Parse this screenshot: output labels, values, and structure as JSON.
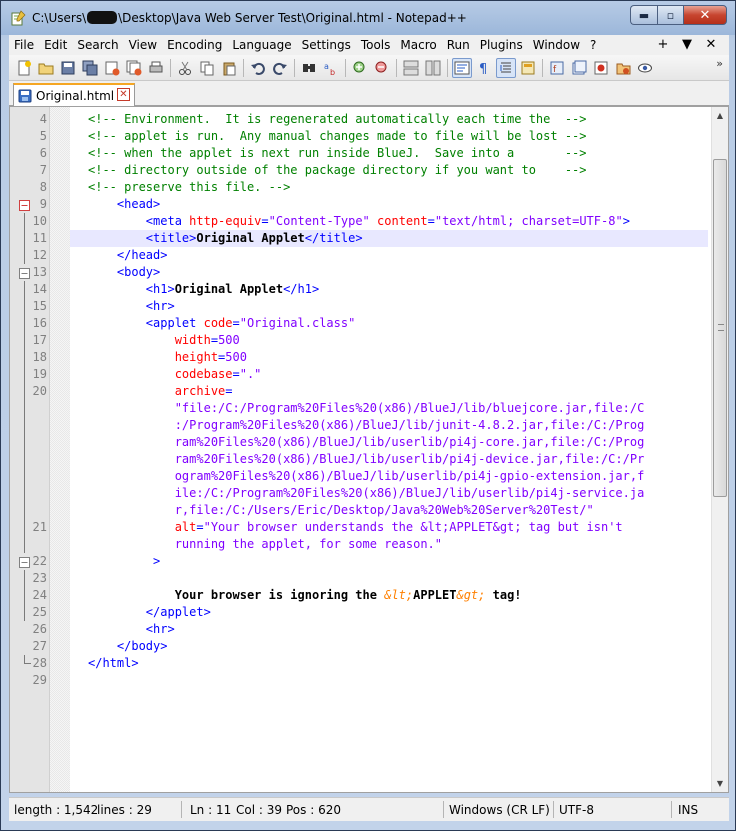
{
  "window": {
    "title_prefix": "C:\\Users\\",
    "title_suffix": "\\Desktop\\Java Web Server Test\\Original.html - Notepad++",
    "minimize_glyph": "▬",
    "maximize_glyph": "▫",
    "close_glyph": "✕"
  },
  "menu": {
    "items": [
      "File",
      "Edit",
      "Search",
      "View",
      "Encoding",
      "Language",
      "Settings",
      "Tools",
      "Macro",
      "Run",
      "Plugins",
      "Window",
      "?"
    ],
    "right": [
      "+",
      "▼",
      "✕"
    ]
  },
  "toolbar": {
    "more": "»",
    "icons": [
      "new-file-icon",
      "open-file-icon",
      "save-icon",
      "save-all-icon",
      "close-icon",
      "close-all-icon",
      "print-icon",
      "cut-icon",
      "copy-icon",
      "paste-icon",
      "undo-icon",
      "redo-icon",
      "find-icon",
      "replace-icon",
      "zoom-in-icon",
      "zoom-out-icon",
      "sync-v-icon",
      "sync-h-icon",
      "wrap-icon",
      "show-all-chars-icon",
      "indent-guide-icon",
      "doc-map-icon",
      "function-list-icon",
      "folder-as-workspace-icon",
      "macro-record-icon",
      "macro-play-icon",
      "monitor-icon"
    ]
  },
  "tab": {
    "label": "Original.html",
    "close_glyph": "✕"
  },
  "editor": {
    "lines": [
      {
        "n": "4",
        "segs": [
          [
            "c-com",
            "<!-- Environment.  It is regenerated automatically each time the  -->"
          ]
        ]
      },
      {
        "n": "5",
        "segs": [
          [
            "c-com",
            "<!-- applet is run.  Any manual changes made to file will be lost -->"
          ]
        ]
      },
      {
        "n": "6",
        "segs": [
          [
            "c-com",
            "<!-- when the applet is next run inside BlueJ.  Save into a       -->"
          ]
        ]
      },
      {
        "n": "7",
        "segs": [
          [
            "c-com",
            "<!-- directory outside of the package directory if you want to    -->"
          ]
        ]
      },
      {
        "n": "8",
        "segs": [
          [
            "c-com",
            "<!-- preserve this file. -->"
          ]
        ]
      },
      {
        "n": "9",
        "segs": [
          [
            "c-tag",
            "    <head>"
          ]
        ]
      },
      {
        "n": "10",
        "segs": [
          [
            "c-tag",
            "        <meta "
          ],
          [
            "c-attr",
            "http-equiv"
          ],
          [
            "c-tag",
            "="
          ],
          [
            "c-val",
            "\"Content-Type\""
          ],
          [
            "c-tag",
            " "
          ],
          [
            "c-attr",
            "content"
          ],
          [
            "c-tag",
            "="
          ],
          [
            "c-val",
            "\"text/html; charset=UTF-8\""
          ],
          [
            "c-tag",
            ">"
          ]
        ]
      },
      {
        "n": "11",
        "segs": [
          [
            "c-tag",
            "        <title>"
          ],
          [
            "c-txt",
            "Original Applet"
          ],
          [
            "c-tag",
            "</title>"
          ]
        ]
      },
      {
        "n": "12",
        "segs": [
          [
            "c-tag",
            "    </head>"
          ]
        ]
      },
      {
        "n": "13",
        "segs": [
          [
            "c-tag",
            "    <body>"
          ]
        ]
      },
      {
        "n": "14",
        "segs": [
          [
            "c-tag",
            "        <h1>"
          ],
          [
            "c-txt",
            "Original Applet"
          ],
          [
            "c-tag",
            "</h1>"
          ]
        ]
      },
      {
        "n": "15",
        "segs": [
          [
            "c-tag",
            "        <hr>"
          ]
        ]
      },
      {
        "n": "16",
        "segs": [
          [
            "c-tag",
            "        <applet "
          ],
          [
            "c-attr",
            "code"
          ],
          [
            "c-tag",
            "="
          ],
          [
            "c-val",
            "\"Original.class\""
          ]
        ]
      },
      {
        "n": "17",
        "segs": [
          [
            "c-attr",
            "            width"
          ],
          [
            "c-tag",
            "="
          ],
          [
            "c-val",
            "500"
          ]
        ]
      },
      {
        "n": "18",
        "segs": [
          [
            "c-attr",
            "            height"
          ],
          [
            "c-tag",
            "="
          ],
          [
            "c-val",
            "500"
          ]
        ]
      },
      {
        "n": "19",
        "segs": [
          [
            "c-attr",
            "            codebase"
          ],
          [
            "c-tag",
            "="
          ],
          [
            "c-val",
            "\".\""
          ]
        ]
      },
      {
        "n": "20",
        "segs": [
          [
            "c-attr",
            "            archive"
          ],
          [
            "c-tag",
            "="
          ]
        ]
      },
      {
        "n": "",
        "segs": [
          [
            "c-val",
            "            \"file:/C:/Program%20Files%20(x86)/BlueJ/lib/bluejcore.jar,file:/C"
          ]
        ]
      },
      {
        "n": "",
        "segs": [
          [
            "c-val",
            "            :/Program%20Files%20(x86)/BlueJ/lib/junit-4.8.2.jar,file:/C:/Prog"
          ]
        ]
      },
      {
        "n": "",
        "segs": [
          [
            "c-val",
            "            ram%20Files%20(x86)/BlueJ/lib/userlib/pi4j-core.jar,file:/C:/Prog"
          ]
        ]
      },
      {
        "n": "",
        "segs": [
          [
            "c-val",
            "            ram%20Files%20(x86)/BlueJ/lib/userlib/pi4j-device.jar,file:/C:/Pr"
          ]
        ]
      },
      {
        "n": "",
        "segs": [
          [
            "c-val",
            "            ogram%20Files%20(x86)/BlueJ/lib/userlib/pi4j-gpio-extension.jar,f"
          ]
        ]
      },
      {
        "n": "",
        "segs": [
          [
            "c-val",
            "            ile:/C:/Program%20Files%20(x86)/BlueJ/lib/userlib/pi4j-service.ja"
          ]
        ]
      },
      {
        "n": "",
        "segs": [
          [
            "c-val",
            "            r,file:/C:/Users/Eric/Desktop/Java%20Web%20Server%20Test/\""
          ]
        ]
      },
      {
        "n": "21",
        "segs": [
          [
            "c-attr",
            "            alt"
          ],
          [
            "c-tag",
            "="
          ],
          [
            "c-val",
            "\"Your browser understands the &lt;APPLET&gt; tag but isn't"
          ]
        ]
      },
      {
        "n": "",
        "segs": [
          [
            "c-val",
            "            running the applet, for some reason.\""
          ]
        ]
      },
      {
        "n": "22",
        "segs": [
          [
            "c-tag",
            "         >"
          ]
        ]
      },
      {
        "n": "23",
        "segs": [
          [
            "c-txt",
            ""
          ]
        ]
      },
      {
        "n": "24",
        "segs": [
          [
            "c-txt",
            "            Your browser is ignoring the "
          ],
          [
            "c-ent",
            "&lt;"
          ],
          [
            "c-txt",
            "APPLET"
          ],
          [
            "c-ent",
            "&gt;"
          ],
          [
            "c-txt",
            " tag!"
          ]
        ]
      },
      {
        "n": "25",
        "segs": [
          [
            "c-tag",
            "        </applet>"
          ]
        ]
      },
      {
        "n": "26",
        "segs": [
          [
            "c-tag",
            "        <hr>"
          ]
        ]
      },
      {
        "n": "27",
        "segs": [
          [
            "c-tag",
            "    </body>"
          ]
        ]
      },
      {
        "n": "28",
        "segs": [
          [
            "c-tag",
            "</html>"
          ]
        ]
      },
      {
        "n": "29",
        "segs": [
          [
            "c-txt",
            ""
          ]
        ]
      }
    ]
  },
  "status": {
    "length": "length : 1,542",
    "lines": "lines : 29",
    "ln": "Ln : 11",
    "col": "Col : 39",
    "pos": "Pos : 620",
    "eol": "Windows (CR LF)",
    "encoding": "UTF-8",
    "mode": "INS"
  }
}
